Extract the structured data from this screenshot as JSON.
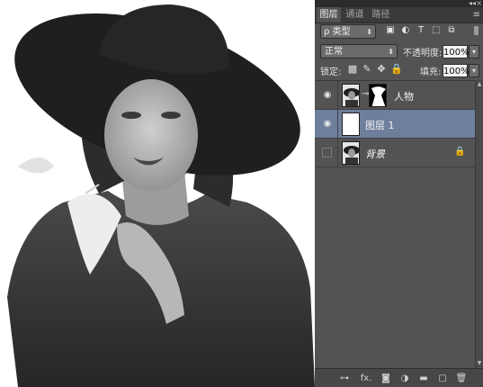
{
  "app": {
    "accent_selected": "#6e7f9c",
    "panel_bg": "#535353"
  },
  "canvas": {
    "image_description_icon": "photo-canvas"
  },
  "panel": {
    "collapse_glyph": "◂◂",
    "close_glyph": "×",
    "menu_glyph": "≡",
    "tabs": [
      {
        "label": "图层",
        "active": true
      },
      {
        "label": "通道",
        "active": false
      },
      {
        "label": "路径",
        "active": false
      }
    ],
    "filter": {
      "kind_label": "ρ 类型",
      "kind_caret": "⬍",
      "icons": [
        "image-filter-icon",
        "adjustment-filter-icon",
        "type-filter-icon",
        "shape-filter-icon",
        "smart-object-filter-icon"
      ],
      "icon_glyphs": [
        "▣",
        "◐",
        "T",
        "⬚",
        "⧉"
      ]
    },
    "blend_mode": {
      "value": "正常",
      "caret": "⬍"
    },
    "opacity": {
      "label": "不透明度:",
      "value": "100%",
      "caret": "▾"
    },
    "lock": {
      "label": "锁定:",
      "icons": [
        "lock-transparent-icon",
        "lock-brush-icon",
        "lock-move-icon",
        "lock-all-icon"
      ],
      "glyphs": [
        "▩",
        "✎",
        "✥",
        "🔒"
      ]
    },
    "fill": {
      "label": "填充:",
      "value": "100%",
      "caret": "▾"
    },
    "layers": [
      {
        "name": "人物",
        "visible": true,
        "selected": false,
        "has_mask": true,
        "italic": false
      },
      {
        "name": "图层 1",
        "visible": true,
        "selected": true,
        "has_mask": false,
        "italic": false
      },
      {
        "name": "背景",
        "visible": false,
        "selected": false,
        "has_mask": false,
        "italic": true,
        "locked": true
      }
    ],
    "eye_glyph": "◉",
    "link_glyph": "⊸",
    "lock_glyph": "🔒",
    "bottom_icons": [
      {
        "name": "link-layers-icon",
        "glyph": "⊶"
      },
      {
        "name": "fx-icon",
        "glyph": "fx."
      },
      {
        "name": "add-mask-icon",
        "glyph": "◙"
      },
      {
        "name": "adjustment-layer-icon",
        "glyph": "◑"
      },
      {
        "name": "new-group-icon",
        "glyph": "▬"
      },
      {
        "name": "new-layer-icon",
        "glyph": "▢"
      },
      {
        "name": "delete-layer-icon",
        "glyph": "🗑"
      }
    ]
  }
}
